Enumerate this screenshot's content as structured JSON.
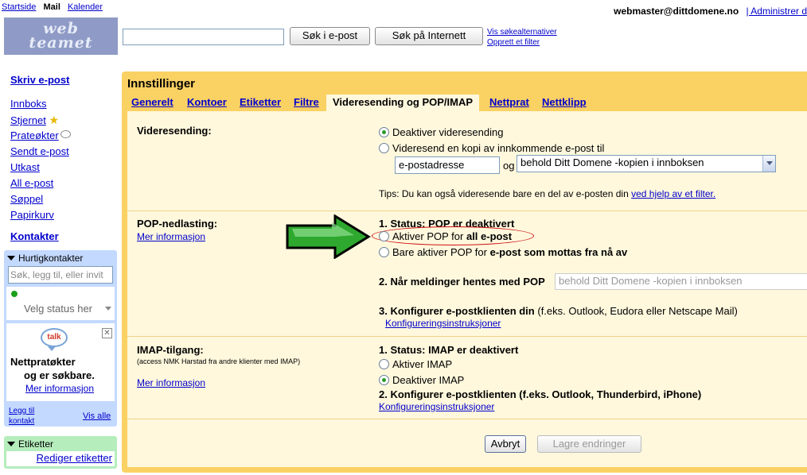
{
  "topnav": {
    "start": "Startside",
    "mail": "Mail",
    "calendar": "Kalender"
  },
  "account": {
    "email": "webmaster@dittdomene.no",
    "admin": "| Administrer d"
  },
  "logo": {
    "line1": "web",
    "line2": "teamet"
  },
  "search": {
    "mail_button": "Søk i e-post",
    "web_button": "Søk på Internett",
    "show_options": "Vis søkealternativer",
    "create_filter": "Opprett et filter"
  },
  "sidebar": {
    "compose": "Skriv e-post",
    "items": [
      {
        "label": "Innboks"
      },
      {
        "label": "Stjernet"
      },
      {
        "label": "Prateøkter"
      },
      {
        "label": "Sendt e-post"
      },
      {
        "label": "Utkast"
      },
      {
        "label": "All e-post"
      },
      {
        "label": "Søppel"
      },
      {
        "label": "Papirkurv"
      }
    ],
    "contacts": "Kontakter",
    "quick_contacts": {
      "title": "Hurtigkontakter",
      "search_placeholder": "Søk, legg til, eller invit",
      "status": "Velg status her",
      "talk_icon": "talk",
      "talk_line1": "Nettpratøkter",
      "talk_line2": "og er søkbare.",
      "talk_more": "Mer informasjon",
      "add_contact_1": "Legg til",
      "add_contact_2": "kontakt",
      "see_all": "Vis alle"
    },
    "labels": {
      "title": "Etiketter",
      "edit": "Rediger etiketter"
    }
  },
  "settings": {
    "title": "Innstillinger",
    "tabs": [
      {
        "label": "Generelt"
      },
      {
        "label": "Kontoer"
      },
      {
        "label": "Etiketter"
      },
      {
        "label": "Filtre"
      },
      {
        "label": "Videresending og POP/IMAP"
      },
      {
        "label": "Nettprat"
      },
      {
        "label": "Nettklipp"
      }
    ],
    "forwarding": {
      "label": "Videresending:",
      "opt_disable": "Deaktiver videresending",
      "opt_forward": "Videresend en kopi av innkommende e-post til",
      "address_value": "e-postadresse",
      "and": "og",
      "keep_option": "behold  Ditt Domene -kopien i innboksen",
      "tip": "Tips: Du kan også videresende bare en del av e-posten din",
      "tip_link": "ved hjelp av et filter."
    },
    "pop": {
      "label": "POP-nedlasting:",
      "more": "Mer informasjon",
      "status": "1. Status: POP er deaktivert",
      "opt_all_prefix": "Aktiver POP for ",
      "opt_all_bold": "all e-post",
      "opt_new_prefix": "Bare aktiver POP for ",
      "opt_new_bold": "e-post som mottas fra nå av",
      "step2": "2. Når meldinger hentes med POP",
      "step2_select": "behold  Ditt Domene -kopien i innboksen",
      "step3": "3. Konfigurer e-postklienten din",
      "step3_suffix": " (f.eks. Outlook, Eudora eller Netscape Mail)",
      "instructions": "Konfigureringsinstruksjoner"
    },
    "imap": {
      "label": "IMAP-tilgang:",
      "sub": "(access NMK Harstad fra andre klienter med IMAP)",
      "more": "Mer informasjon",
      "status": "1. Status: IMAP er deaktivert",
      "opt_enable": "Aktiver IMAP",
      "opt_disable": "Deaktiver IMAP",
      "step2": "2. Konfigurer e-postklienten (f.eks. Outlook, Thunderbird, iPhone)",
      "instructions": "Konfigureringsinstruksjoner"
    },
    "cancel": "Avbryt",
    "save": "Lagre endringer"
  }
}
